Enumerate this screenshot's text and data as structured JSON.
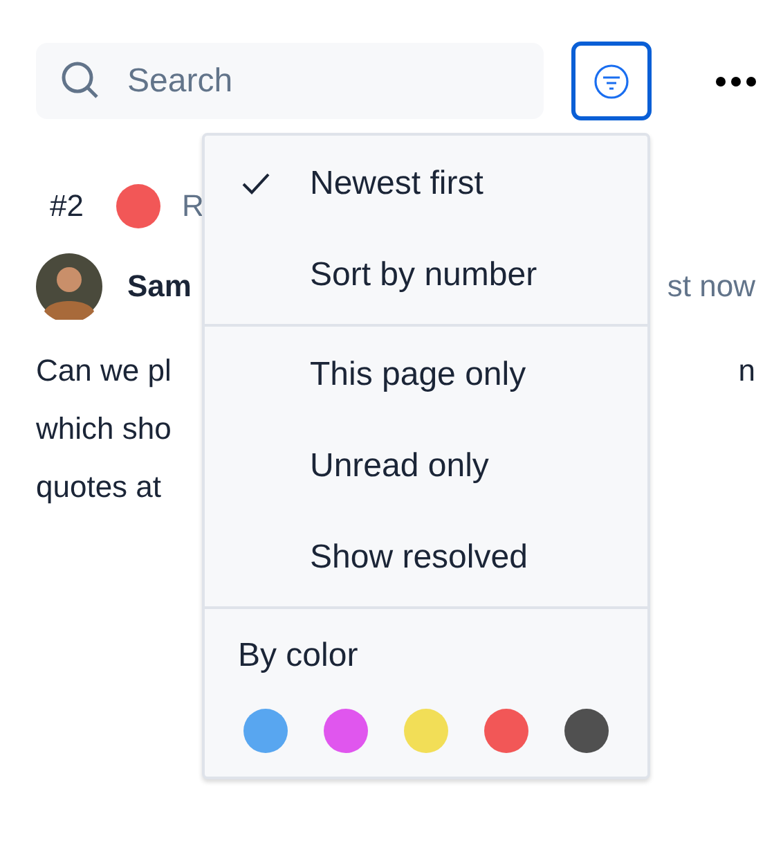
{
  "search": {
    "placeholder": "Search"
  },
  "filter_button": {
    "active": true
  },
  "comment": {
    "number": "#2",
    "color": "#f25757",
    "status": "R",
    "author": "Sam",
    "time": "st now",
    "lines": [
      {
        "left": "Can we pl",
        "right": "n"
      },
      {
        "left": "which sho"
      },
      {
        "left": "quotes at"
      }
    ]
  },
  "menu": {
    "sort_options": [
      {
        "label": "Newest first",
        "selected": true
      },
      {
        "label": "Sort by number",
        "selected": false
      }
    ],
    "filters": [
      {
        "label": "This page only",
        "checked": false
      },
      {
        "label": "Unread only",
        "checked": false
      },
      {
        "label": "Show resolved",
        "checked": false
      }
    ],
    "color_heading": "By color",
    "colors": [
      {
        "color": "#58a6f0"
      },
      {
        "color": "#e056ee"
      },
      {
        "color": "#f2de57"
      },
      {
        "color": "#f25757"
      },
      {
        "color": "#505050"
      }
    ]
  }
}
